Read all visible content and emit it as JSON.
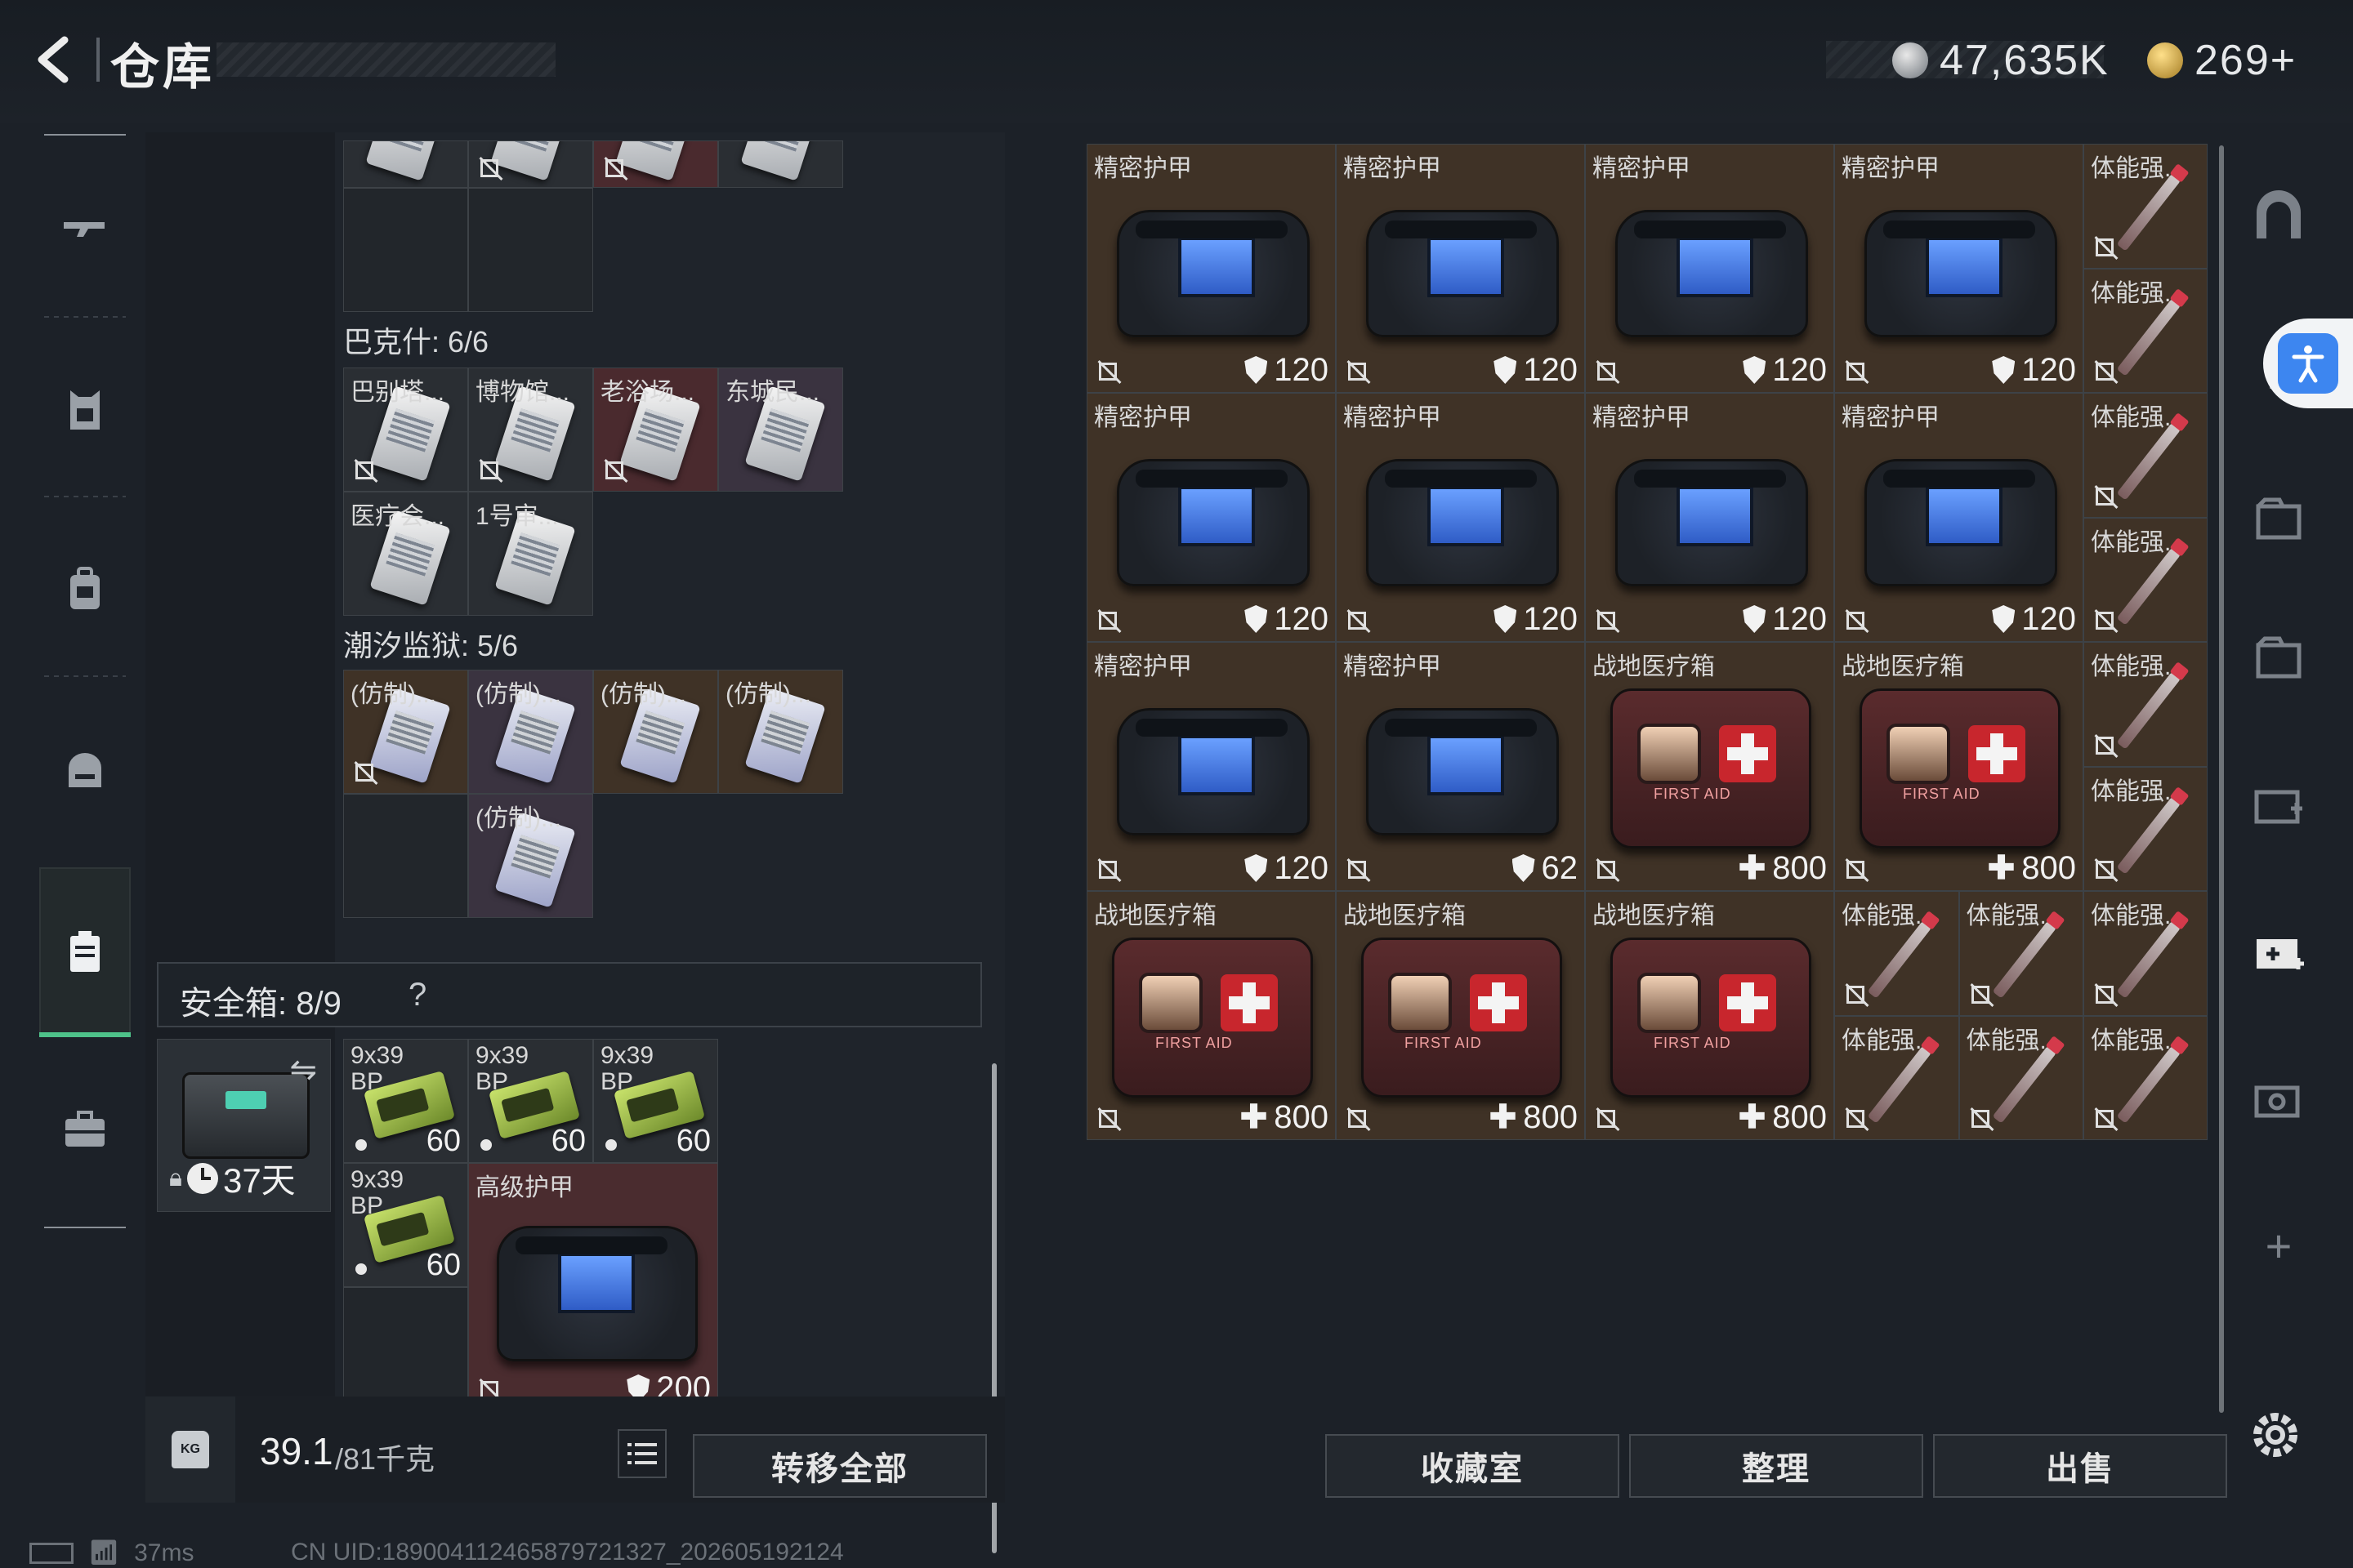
{
  "header": {
    "title": "仓库",
    "currency_silver": "47,635K",
    "currency_gold": "269+"
  },
  "left_nav": {
    "items": [
      {
        "icon": "rifle-icon"
      },
      {
        "icon": "armor-vest-icon"
      },
      {
        "icon": "backpack-icon"
      },
      {
        "icon": "helmet-bag-icon"
      },
      {
        "icon": "container-icon",
        "active": true
      },
      {
        "icon": "briefcase-icon"
      }
    ]
  },
  "storage": {
    "top_row_cells": [
      "",
      "",
      "",
      ""
    ],
    "section_bakesh": {
      "title": "巴克什: 6/6",
      "cards": [
        "巴别塔...",
        "博物馆...",
        "老浴场...",
        "东城民...",
        "医疗会...",
        "1号审..."
      ]
    },
    "section_tide": {
      "title": "潮汐监狱: 5/6",
      "cards": [
        "(仿制)...",
        "(仿制)...",
        "(仿制)...",
        "(仿制)...",
        "(仿制)..."
      ]
    },
    "safe_box": {
      "label": "安全箱: 8/9",
      "help": "?",
      "timer": "37天",
      "ammo": [
        {
          "label": "9x39\nBP",
          "qty": "60"
        },
        {
          "label": "9x39\nBP",
          "qty": "60"
        },
        {
          "label": "9x39\nBP",
          "qty": "60"
        },
        {
          "label": "9x39\nBP",
          "qty": "60"
        }
      ],
      "armor_label": "高级护甲",
      "armor_value": "200"
    },
    "weight": {
      "current": "39.1",
      "max": "/81千克"
    },
    "transfer_all": "转移全部"
  },
  "stash": {
    "rows": [
      [
        {
          "name": "精密护甲",
          "type": "armor",
          "value": "120"
        },
        {
          "name": "精密护甲",
          "type": "armor",
          "value": "120"
        },
        {
          "name": "精密护甲",
          "type": "armor",
          "value": "120"
        },
        {
          "name": "精密护甲",
          "type": "armor",
          "value": "120"
        }
      ],
      [
        {
          "name": "精密护甲",
          "type": "armor",
          "value": "120"
        },
        {
          "name": "精密护甲",
          "type": "armor",
          "value": "120"
        },
        {
          "name": "精密护甲",
          "type": "armor",
          "value": "120"
        },
        {
          "name": "精密护甲",
          "type": "armor",
          "value": "120"
        }
      ],
      [
        {
          "name": "精密护甲",
          "type": "armor",
          "value": "120"
        },
        {
          "name": "精密护甲",
          "type": "armor",
          "value": "62"
        },
        {
          "name": "战地医疗箱",
          "type": "medkit",
          "value": "800"
        },
        {
          "name": "战地医疗箱",
          "type": "medkit",
          "value": "800"
        }
      ],
      [
        {
          "name": "战地医疗箱",
          "type": "medkit",
          "value": "800"
        },
        {
          "name": "战地医疗箱",
          "type": "medkit",
          "value": "800"
        },
        {
          "name": "战地医疗箱",
          "type": "medkit",
          "value": "800"
        }
      ]
    ],
    "syringe_label": "体能强...",
    "medkit_text": "FIRST AID"
  },
  "footer": {
    "collection": "收藏室",
    "organize": "整理",
    "sell": "出售"
  },
  "status": {
    "ping": "37ms",
    "uid": "CN UID:1890041124658797213​27_202605192124"
  }
}
